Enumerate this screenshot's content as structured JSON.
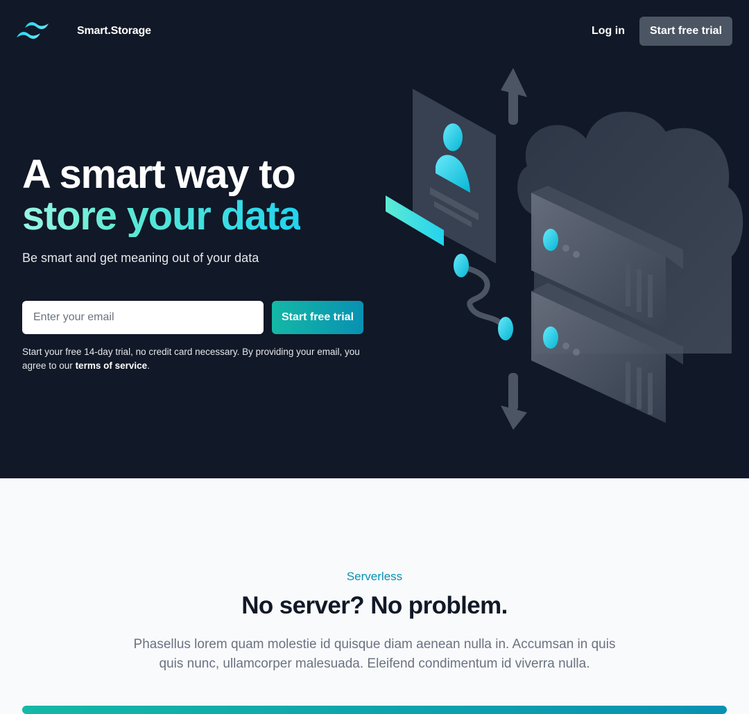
{
  "nav": {
    "brand": "Smart.Storage",
    "login_label": "Log in",
    "cta_label": "Start free trial",
    "cta_color": "#4b5563"
  },
  "hero": {
    "headline_line1": "A smart way to",
    "headline_line2": "store your data",
    "subheading": "Be smart and get meaning out of your data",
    "email_placeholder": "Enter your email",
    "email_value": "",
    "cta_label": "Start free trial",
    "fine_print": "Start your free 14-day trial, no credit card necessary. By providing your email, you agree to our ",
    "terms_link": "terms of service",
    "fine_print_end": ".",
    "background_color": "#111827",
    "accent_gradient": [
      "#99f6e4",
      "#22d3ee"
    ],
    "illustration_icons": [
      "logo-waves-icon",
      "cloud-storage-illustration",
      "up-arrow-icon",
      "down-arrow-icon",
      "user-card-icon",
      "server-rack-icon"
    ]
  },
  "feature": {
    "eyebrow": "Serverless",
    "title": "No server? No problem.",
    "body": "Phasellus lorem quam molestie id quisque diam aenean nulla in. Accumsan in quis quis nunc, ullamcorper malesuada. Eleifend condimentum id viverra nulla.",
    "eyebrow_color": "#0891b2"
  }
}
